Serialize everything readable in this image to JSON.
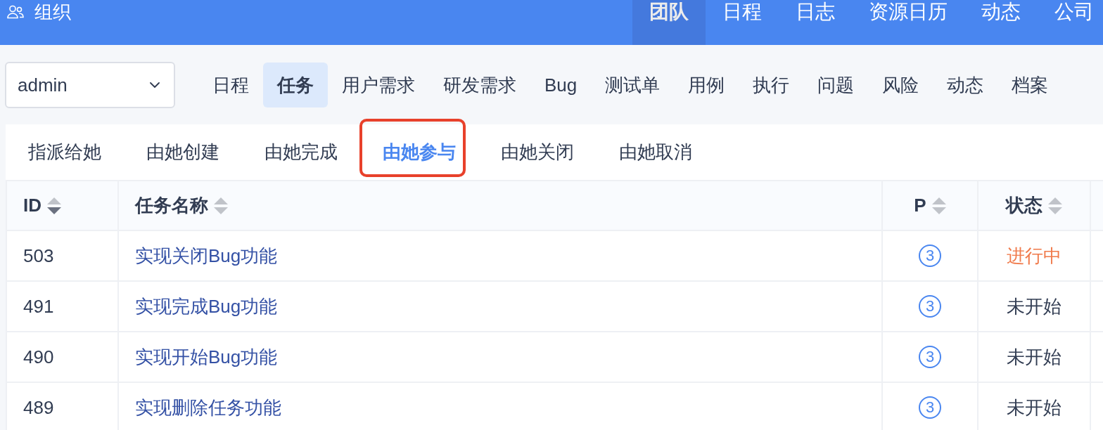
{
  "header": {
    "title": "组织",
    "nav": [
      {
        "label": "团队",
        "selected": true
      },
      {
        "label": "日程",
        "selected": false
      },
      {
        "label": "日志",
        "selected": false
      },
      {
        "label": "资源日历",
        "selected": false
      },
      {
        "label": "动态",
        "selected": false
      },
      {
        "label": "公司",
        "selected": false
      }
    ]
  },
  "user_select": {
    "value": "admin"
  },
  "module_tabs": [
    {
      "label": "日程",
      "selected": false
    },
    {
      "label": "任务",
      "selected": true
    },
    {
      "label": "用户需求",
      "selected": false
    },
    {
      "label": "研发需求",
      "selected": false
    },
    {
      "label": "Bug",
      "selected": false
    },
    {
      "label": "测试单",
      "selected": false
    },
    {
      "label": "用例",
      "selected": false
    },
    {
      "label": "执行",
      "selected": false
    },
    {
      "label": "问题",
      "selected": false
    },
    {
      "label": "风险",
      "selected": false
    },
    {
      "label": "动态",
      "selected": false
    },
    {
      "label": "档案",
      "selected": false
    }
  ],
  "sub_tabs": [
    {
      "label": "指派给她",
      "selected": false,
      "highlighted": false
    },
    {
      "label": "由她创建",
      "selected": false,
      "highlighted": false
    },
    {
      "label": "由她完成",
      "selected": false,
      "highlighted": false
    },
    {
      "label": "由她参与",
      "selected": true,
      "highlighted": true
    },
    {
      "label": "由她关闭",
      "selected": false,
      "highlighted": false
    },
    {
      "label": "由她取消",
      "selected": false,
      "highlighted": false
    }
  ],
  "table": {
    "columns": [
      {
        "label": "ID",
        "sorted_descending": true
      },
      {
        "label": "任务名称",
        "sorted_descending": false
      },
      {
        "label": "P",
        "sorted_descending": false
      },
      {
        "label": "状态",
        "sorted_descending": false
      }
    ],
    "rows": [
      {
        "id": "503",
        "name": "实现关闭Bug功能",
        "priority": "3",
        "status": {
          "label": "进行中",
          "color": "#f07a4b"
        }
      },
      {
        "id": "491",
        "name": "实现完成Bug功能",
        "priority": "3",
        "status": {
          "label": "未开始",
          "color": "#313c52"
        }
      },
      {
        "id": "490",
        "name": "实现开始Bug功能",
        "priority": "3",
        "status": {
          "label": "未开始",
          "color": "#313c52"
        }
      },
      {
        "id": "489",
        "name": "实现删除任务功能",
        "priority": "3",
        "status": {
          "label": "未开始",
          "color": "#313c52"
        }
      }
    ]
  }
}
